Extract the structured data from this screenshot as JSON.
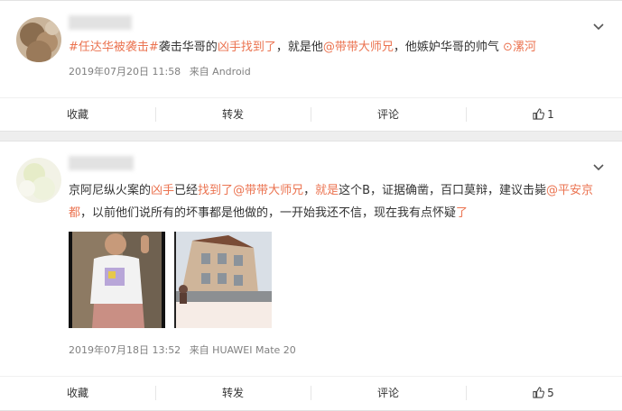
{
  "colors": {
    "link": "#eb7350",
    "meta": "#808080",
    "text": "#333333"
  },
  "posts": [
    {
      "segments": [
        {
          "text": "#任达华被袭击#",
          "type": "topic"
        },
        {
          "text": "袭击华哥的",
          "type": "plain"
        },
        {
          "text": "凶手找到了",
          "type": "link"
        },
        {
          "text": "，就是他",
          "type": "plain"
        },
        {
          "text": "@带带大师兄",
          "type": "mention"
        },
        {
          "text": "，他嫉妒华哥的帅气 ",
          "type": "plain"
        },
        {
          "text": "⊙漯河",
          "type": "loc"
        }
      ],
      "time": "2019年07月20日 11:58",
      "source": "来自 Android",
      "actions": {
        "fav": "收藏",
        "share": "转发",
        "comment": "评论",
        "likes": "1"
      }
    },
    {
      "segments": [
        {
          "text": "京阿尼纵火案的",
          "type": "plain"
        },
        {
          "text": "凶手",
          "type": "link"
        },
        {
          "text": "已经",
          "type": "plain"
        },
        {
          "text": "找到了",
          "type": "link"
        },
        {
          "text": "@带带大师兄",
          "type": "mention"
        },
        {
          "text": "，",
          "type": "plain"
        },
        {
          "text": "就是",
          "type": "link"
        },
        {
          "text": "这个B，证据确凿，百口莫辩，建议击毙",
          "type": "plain"
        },
        {
          "text": "@平安京都",
          "type": "mention"
        },
        {
          "text": "，以前他们说所有的坏事都是他做的，一开始我还不信，现在我有点怀疑",
          "type": "plain"
        },
        {
          "text": "了",
          "type": "link"
        }
      ],
      "time": "2019年07月18日 13:52",
      "source": "来自 HUAWEI Mate 20",
      "actions": {
        "fav": "收藏",
        "share": "转发",
        "comment": "评论",
        "likes": "5"
      }
    }
  ]
}
